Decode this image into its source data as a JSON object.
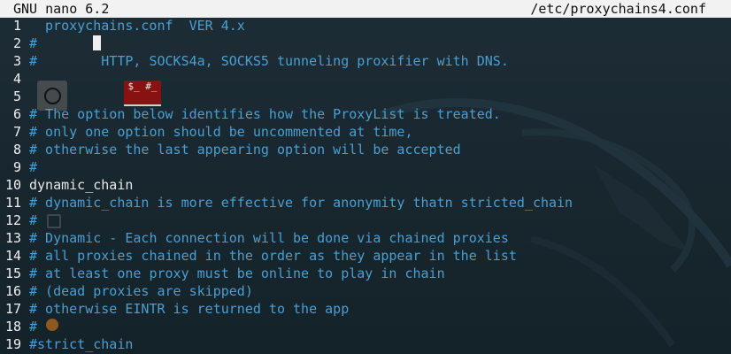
{
  "editor": {
    "app_version": "GNU nano 6.2",
    "file_path": "/etc/proxychains4.conf"
  },
  "lines": [
    {
      "num": "1",
      "text": " proxychains.conf  VER 4.x",
      "kind": "comment",
      "cursor": true,
      "cursor_char": "#"
    },
    {
      "num": "2",
      "text": "#",
      "kind": "comment"
    },
    {
      "num": "3",
      "text": "#        HTTP, SOCKS4a, SOCKS5 tunneling proxifier with DNS.",
      "kind": "comment"
    },
    {
      "num": "4",
      "text": "",
      "kind": "blank"
    },
    {
      "num": "5",
      "text": "",
      "kind": "blank"
    },
    {
      "num": "6",
      "text": "# The option below identifies how the ProxyList is treated.",
      "kind": "comment"
    },
    {
      "num": "7",
      "text": "# only one option should be uncommented at time,",
      "kind": "comment"
    },
    {
      "num": "8",
      "text": "# otherwise the last appearing option will be accepted",
      "kind": "comment"
    },
    {
      "num": "9",
      "text": "#",
      "kind": "comment"
    },
    {
      "num": "10",
      "text": "dynamic_chain",
      "kind": "directive"
    },
    {
      "num": "11",
      "text": "# dynamic_chain is more effective for anonymity thatn stricted_chain",
      "kind": "comment"
    },
    {
      "num": "12",
      "text": "#",
      "kind": "comment"
    },
    {
      "num": "13",
      "text": "# Dynamic - Each connection will be done via chained proxies",
      "kind": "comment"
    },
    {
      "num": "14",
      "text": "# all proxies chained in the order as they appear in the list",
      "kind": "comment"
    },
    {
      "num": "15",
      "text": "# at least one proxy must be online to play in chain",
      "kind": "comment"
    },
    {
      "num": "16",
      "text": "# (dead proxies are skipped)",
      "kind": "comment"
    },
    {
      "num": "17",
      "text": "# otherwise EINTR is returned to the app",
      "kind": "comment"
    },
    {
      "num": "18",
      "text": "#",
      "kind": "comment"
    },
    {
      "num": "19",
      "text": "#strict_chain",
      "kind": "comment"
    }
  ],
  "desktop": {
    "terminal_icon_label": "$_ #_"
  },
  "theme": {
    "background": "#1b2a33",
    "comment": "#4a9fd3",
    "directive": "#e8e8e8",
    "title_bar": "#f2f2f2"
  }
}
